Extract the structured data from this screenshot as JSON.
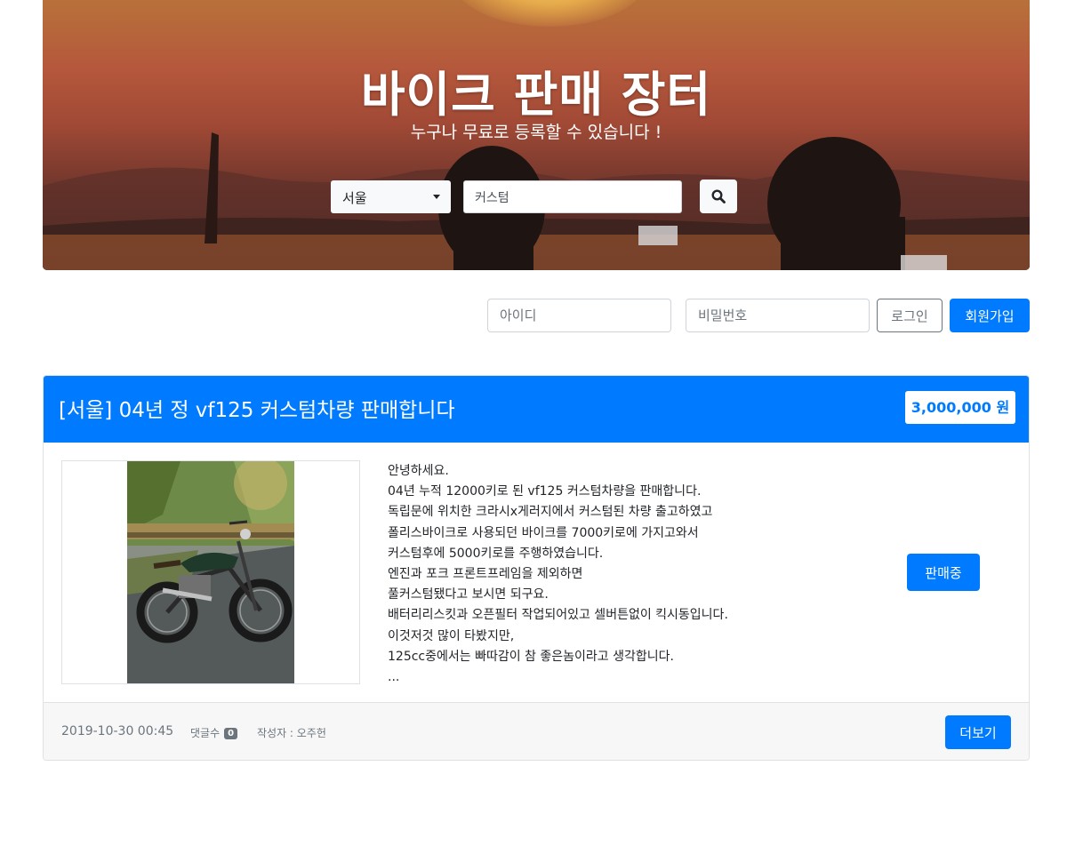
{
  "hero": {
    "title": "바이크 판매 장터",
    "subtitle": "누구나 무료로 등록할 수 있습니다 !",
    "region": "서울",
    "search_value": "커스텀",
    "search_icon": "search-icon"
  },
  "login": {
    "id_placeholder": "아이디",
    "password_placeholder": "비밀번호",
    "login_label": "로그인",
    "signup_label": "회원가입"
  },
  "listing": {
    "title": "[서울] 04년 정 vf125 커스텀차량 판매합니다",
    "price": "3,000,000 원",
    "description": [
      "안녕하세요.",
      "04년 누적 12000키로 된 vf125 커스텀차량을 판매합니다.",
      "독립문에 위치한 크라시x게러지에서 커스텀된 차량 출고하였고",
      "폴리스바이크로 사용되던 바이크를 7000키로에 가지고와서",
      "커스텀후에 5000키로를 주행하였습니다.",
      "엔진과 포크 프론트프레임을 제외하면",
      "풀커스텀됐다고 보시면 되구요.",
      "배터리리스킷과 오픈필터 작업되어있고 셀버튼없이 킥시동입니다.",
      "이것저것 많이 타봤지만,",
      "125cc중에서는 빠따감이 참 좋은놈이라고 생각합니다.",
      "..."
    ],
    "status_label": "판매중",
    "date": "2019-10-30 00:45",
    "comments_label": "댓글수",
    "comments_count": "0",
    "author": "작성자 : 오주헌",
    "more_label": "더보기"
  },
  "colors": {
    "primary": "#007bff",
    "secondary": "#6c757d"
  }
}
